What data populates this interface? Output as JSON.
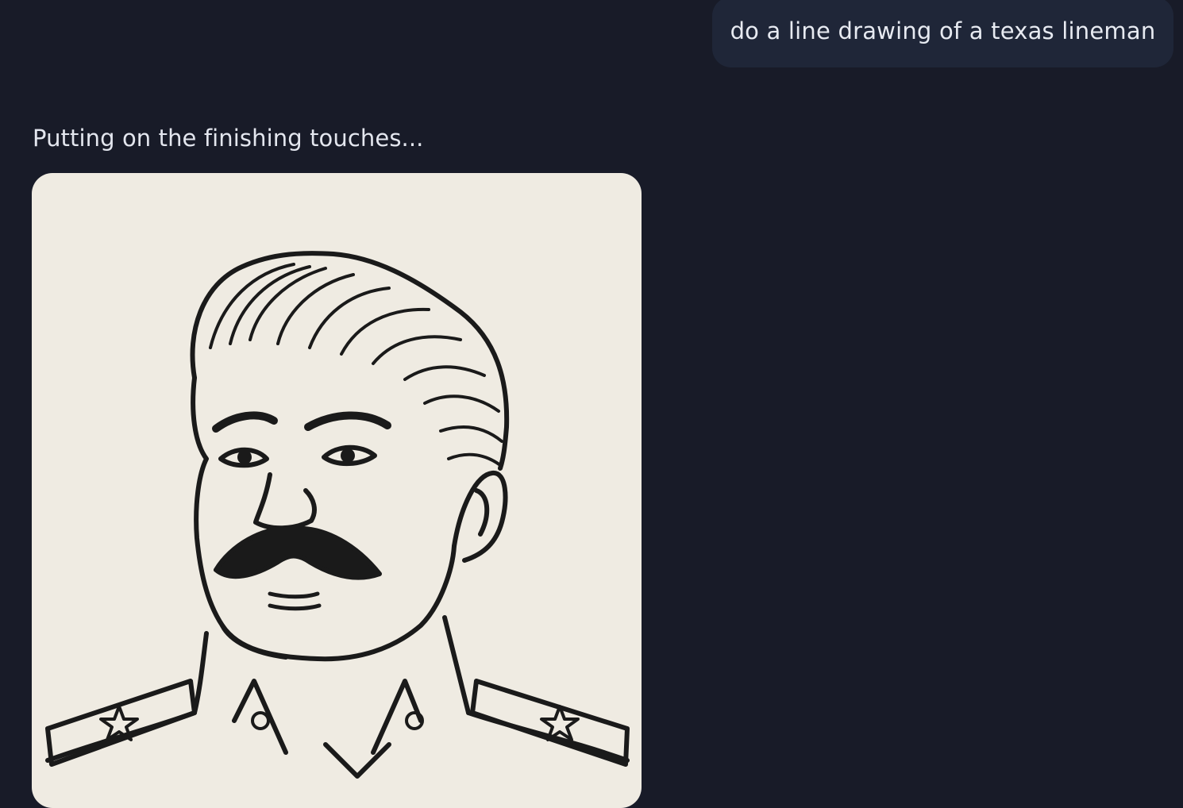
{
  "chat": {
    "user_message": "do a line drawing of a texas lineman",
    "assistant_status": "Putting on the finishing touches..."
  },
  "generated_image": {
    "subject": "line-drawing-portrait",
    "background_color": "#efebe2",
    "ink_color": "#1a1a1a"
  },
  "colors": {
    "page_background": "#181b28",
    "bubble_background": "#1f2638",
    "text": "#e6e9f0"
  }
}
